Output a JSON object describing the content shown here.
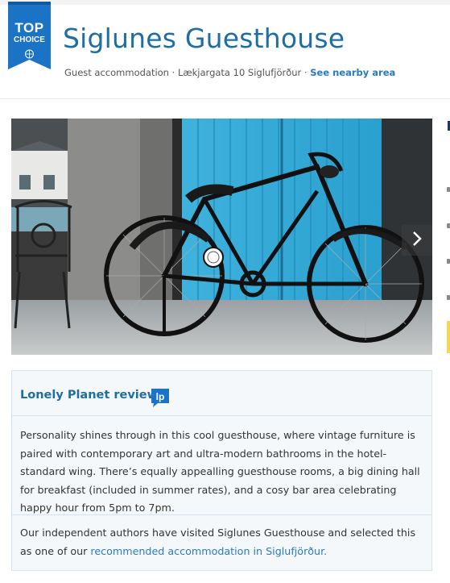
{
  "badge": {
    "top": "TOP",
    "choice": "CHOICE",
    "color": "#1a73c5"
  },
  "listing": {
    "title": "Siglunes Guesthouse",
    "type": "Guest accommodation",
    "sep1": " · ",
    "address": "Lækjargata 10 Siglufjörður",
    "sep2": " · ",
    "nearby_link": "See nearby area"
  },
  "gallery": {
    "next_icon": "chevron-right-icon"
  },
  "review": {
    "heading": "Lonely Planet review",
    "logo_text": "lp",
    "body": "Personality shines through in this cool guesthouse, where vintage furniture is paired with contemporary art and ultra-modern bathrooms in the hotel-standard wing. There’s equally appealling guesthouse rooms, a big dining hall for breakfast (included in summer rates), and a cosy bar area celebrating happy hour from 5pm to 7pm.",
    "footer_prefix": "Our independent authors have visited Siglunes Guesthouse and selected this as one of our ",
    "footer_link": "recommended accommodation in Siglufjörður."
  },
  "colors": {
    "title_blue": "#1f6ea3",
    "link_blue": "#2a7bc0",
    "card_bg": "#f4f8fb"
  }
}
